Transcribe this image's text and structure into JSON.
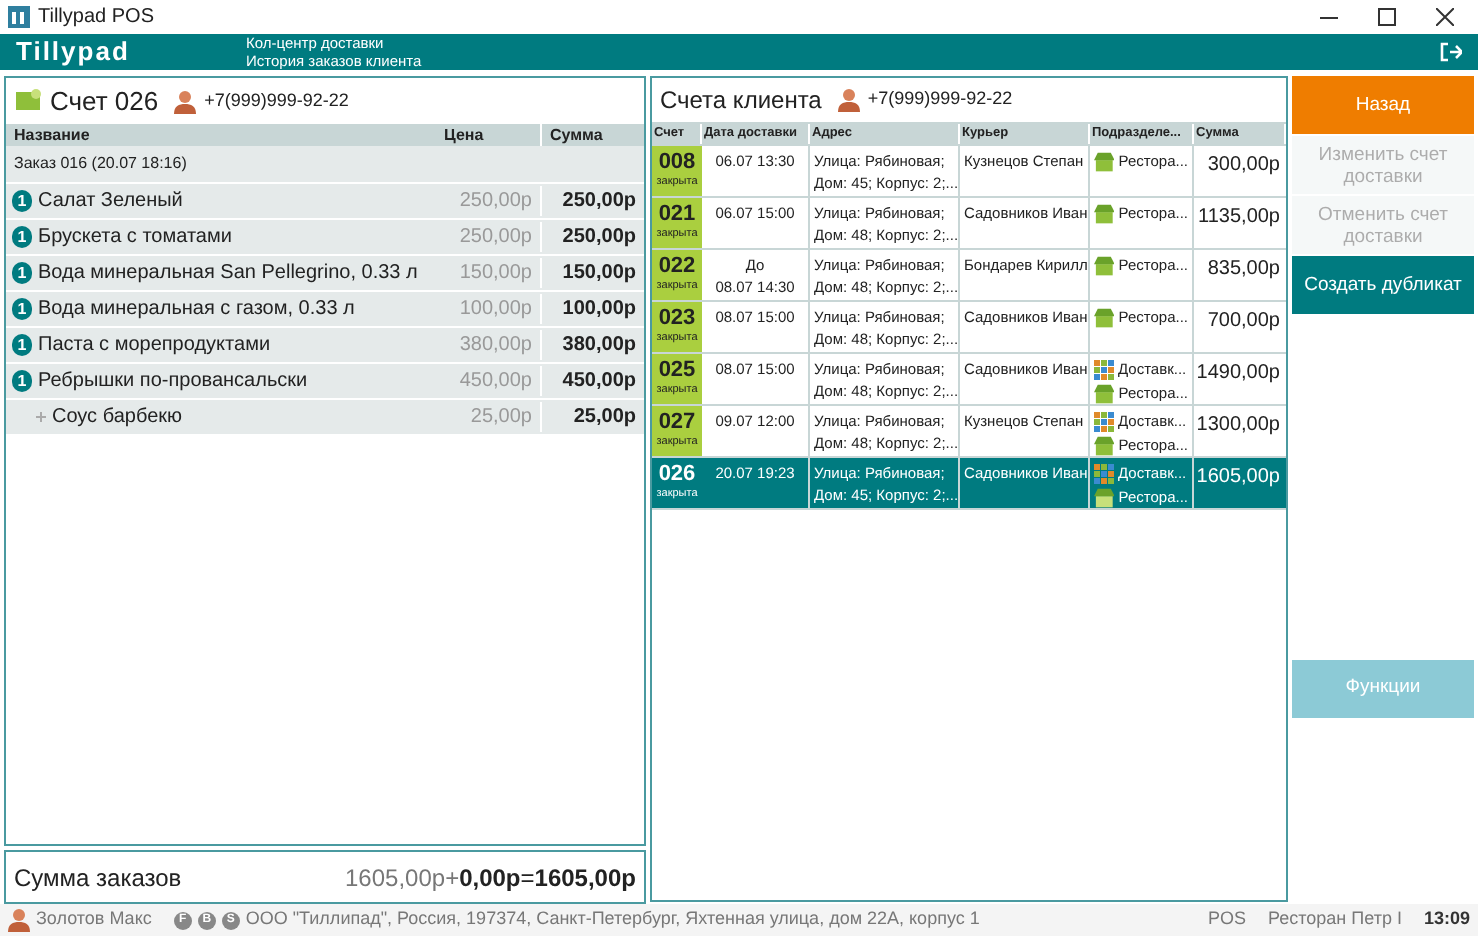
{
  "window": {
    "title": "Tillypad POS"
  },
  "header": {
    "logo": "Tillypad",
    "lines": [
      "Кол-центр доставки",
      "История заказов клиента"
    ]
  },
  "order": {
    "title": "Счет 026",
    "phone": "+7(999)999-92-22",
    "columns": [
      "Название",
      "Цена",
      "Сумма"
    ],
    "group": "Заказ 016 (20.07 18:16)",
    "items": [
      {
        "kind": "item",
        "qty": "1",
        "name": "Салат Зеленый",
        "price": "250,00р",
        "sum": "250,00р"
      },
      {
        "kind": "item",
        "qty": "1",
        "name": "Брускета с томатами",
        "price": "250,00р",
        "sum": "250,00р"
      },
      {
        "kind": "item",
        "qty": "1",
        "name": "Вода минеральная San Pellegrino, 0.33 л",
        "price": "150,00р",
        "sum": "150,00р"
      },
      {
        "kind": "item",
        "qty": "1",
        "name": "Вода минеральная с газом, 0.33 л",
        "price": "100,00р",
        "sum": "100,00р"
      },
      {
        "kind": "item",
        "qty": "1",
        "name": "Паста с морепродуктами",
        "price": "380,00р",
        "sum": "380,00р"
      },
      {
        "kind": "item",
        "qty": "1",
        "name": "Ребрышки по-провансальски",
        "price": "450,00р",
        "sum": "450,00р"
      },
      {
        "kind": "modifier",
        "name": "Соус барбекю",
        "price": "25,00р",
        "sum": "25,00р"
      }
    ],
    "total": {
      "label": "Сумма заказов",
      "amount": "1605,00р",
      "plus": "+",
      "extra": "0,00р",
      "equals": "=",
      "result": "1605,00р"
    }
  },
  "accounts": {
    "title": "Счета клиента",
    "phone": "+7(999)999-92-22",
    "columns": [
      "Счет",
      "Дата доставки",
      "Адрес",
      "Курьер",
      "Подразделе...",
      "Сумма"
    ],
    "rows": [
      {
        "number": "008",
        "status": "закрыта",
        "selected": false,
        "date": [
          "06.07 13:30"
        ],
        "address": [
          "Улица: Рябиновая;",
          "Дом: 45; Корпус: 2;..."
        ],
        "courier": "Кузнецов Степан",
        "units": [
          {
            "kind": "restaurant",
            "text": "Рестора..."
          }
        ],
        "sum": "300,00р"
      },
      {
        "number": "021",
        "status": "закрыта",
        "selected": false,
        "date": [
          "06.07 15:00"
        ],
        "address": [
          "Улица: Рябиновая;",
          "Дом: 48; Корпус: 2;..."
        ],
        "courier": "Садовников Иван",
        "units": [
          {
            "kind": "restaurant",
            "text": "Рестора..."
          }
        ],
        "sum": "1135,00р"
      },
      {
        "number": "022",
        "status": "закрыта",
        "selected": false,
        "date": [
          "До",
          "08.07 14:30"
        ],
        "address": [
          "Улица: Рябиновая;",
          "Дом: 48; Корпус: 2;..."
        ],
        "courier": "Бондарев Кирилл",
        "units": [
          {
            "kind": "restaurant",
            "text": "Рестора..."
          }
        ],
        "sum": "835,00р"
      },
      {
        "number": "023",
        "status": "закрыта",
        "selected": false,
        "date": [
          "08.07 15:00"
        ],
        "address": [
          "Улица: Рябиновая;",
          "Дом: 48; Корпус: 2;..."
        ],
        "courier": "Садовников Иван",
        "units": [
          {
            "kind": "restaurant",
            "text": "Рестора..."
          }
        ],
        "sum": "700,00р"
      },
      {
        "number": "025",
        "status": "закрыта",
        "selected": false,
        "date": [
          "08.07 15:00"
        ],
        "address": [
          "Улица: Рябиновая;",
          "Дом: 48; Корпус: 2;..."
        ],
        "courier": "Садовников Иван",
        "units": [
          {
            "kind": "delivery",
            "text": "Доставк..."
          },
          {
            "kind": "restaurant",
            "text": "Рестора..."
          }
        ],
        "sum": "1490,00р"
      },
      {
        "number": "027",
        "status": "закрыта",
        "selected": false,
        "date": [
          "09.07 12:00"
        ],
        "address": [
          "Улица: Рябиновая;",
          "Дом: 48; Корпус: 2;..."
        ],
        "courier": "Кузнецов Степан",
        "units": [
          {
            "kind": "delivery",
            "text": "Доставк..."
          },
          {
            "kind": "restaurant",
            "text": "Рестора..."
          }
        ],
        "sum": "1300,00р"
      },
      {
        "number": "026",
        "status": "закрыта",
        "selected": true,
        "date": [
          "20.07 19:23"
        ],
        "address": [
          "Улица: Рябиновая;",
          "Дом: 45; Корпус: 2;..."
        ],
        "courier": "Садовников Иван",
        "units": [
          {
            "kind": "delivery",
            "text": "Доставк..."
          },
          {
            "kind": "restaurant",
            "text": "Рестора..."
          }
        ],
        "sum": "1605,00р"
      }
    ]
  },
  "actions": [
    {
      "kind": "primary",
      "label": "Назад",
      "disabled": false
    },
    {
      "kind": "normal",
      "label": "Изменить счет доставки",
      "disabled": true
    },
    {
      "kind": "normal",
      "label": "Отменить счет доставки",
      "disabled": true
    },
    {
      "kind": "accent",
      "label": "Создать дубликат",
      "disabled": false
    }
  ],
  "functions": {
    "label": "Функции",
    "disabled": true
  },
  "status_bar": {
    "user": "Золотов Макс",
    "badges": [
      "F",
      "B",
      "S"
    ],
    "address": "ООО \"Тиллипад\", Россия, 197374, Санкт-Петербург, Яхтенная улица, дом 22А, корпус 1",
    "mode": "POS",
    "restaurant": "Ресторан Петр I",
    "time": "13:09"
  }
}
